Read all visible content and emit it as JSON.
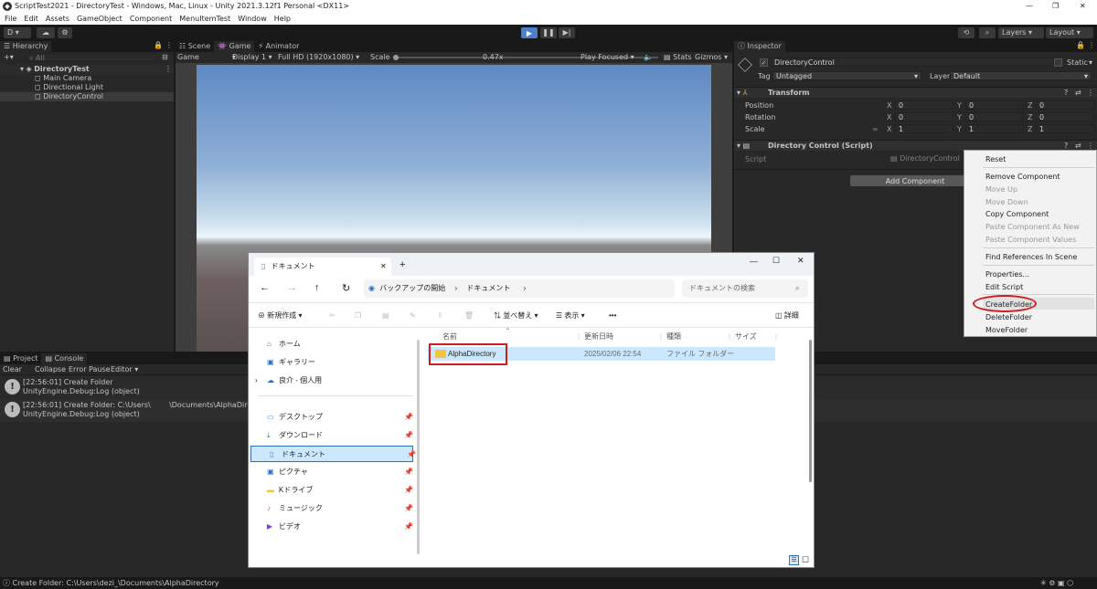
{
  "window": {
    "title": "ScriptTest2021 - DirectoryTest - Windows, Mac, Linux - Unity 2021.3.12f1 Personal <DX11>"
  },
  "menu": [
    "File",
    "Edit",
    "Assets",
    "GameObject",
    "Component",
    "MenuItemTest",
    "Window",
    "Help"
  ],
  "toolbar": {
    "account": "D",
    "layers": "Layers",
    "layout": "Layout"
  },
  "hierarchy": {
    "tab": "Hierarchy",
    "search_placeholder": "All",
    "scene": "DirectoryTest",
    "items": [
      "Main Camera",
      "Directional Light",
      "DirectoryControl"
    ]
  },
  "scene_tabs": {
    "scene": "Scene",
    "game": "Game",
    "animator": "Animator"
  },
  "game_toolbar": {
    "display_mode": "Game",
    "display": "Display 1",
    "resolution": "Full HD (1920x1080)",
    "scale_label": "Scale",
    "scale_value": "0.47x",
    "play_focused": "Play Focused",
    "stats": "Stats",
    "gizmos": "Gizmos"
  },
  "inspector": {
    "tab": "Inspector",
    "object_name": "DirectoryControl",
    "static_label": "Static",
    "tag_label": "Tag",
    "tag_value": "Untagged",
    "layer_label": "Layer",
    "layer_value": "Default",
    "transform": {
      "title": "Transform",
      "rows": [
        {
          "label": "Position",
          "x": "0",
          "y": "0",
          "z": "0"
        },
        {
          "label": "Rotation",
          "x": "0",
          "y": "0",
          "z": "0"
        },
        {
          "label": "Scale",
          "x": "1",
          "y": "1",
          "z": "1"
        }
      ]
    },
    "script_component": {
      "title": "Directory Control (Script)",
      "script_label": "Script",
      "script_value": "DirectoryControl"
    },
    "add_component": "Add Component"
  },
  "context_menu": {
    "items": [
      {
        "label": "Reset",
        "enabled": true
      },
      {
        "label": "Remove Component",
        "enabled": true
      },
      {
        "label": "Move Up",
        "enabled": false
      },
      {
        "label": "Move Down",
        "enabled": false
      },
      {
        "label": "Copy Component",
        "enabled": true
      },
      {
        "label": "Paste Component As New",
        "enabled": false
      },
      {
        "label": "Paste Component Values",
        "enabled": false
      },
      {
        "label": "Find References In Scene",
        "enabled": true
      },
      {
        "label": "Properties...",
        "enabled": true
      },
      {
        "label": "Edit Script",
        "enabled": true
      },
      {
        "label": "CreateFolder",
        "enabled": true
      },
      {
        "label": "DeleteFolder",
        "enabled": true
      },
      {
        "label": "MoveFolder",
        "enabled": true
      }
    ]
  },
  "console": {
    "tabs": {
      "project": "Project",
      "console": "Console"
    },
    "buttons": {
      "clear": "Clear",
      "collapse": "Collapse",
      "error_pause": "Error Pause",
      "editor": "Editor"
    },
    "entries": [
      {
        "line1": "[22:56:01] Create Folder",
        "line2": "UnityEngine.Debug:Log (object)"
      },
      {
        "line1": "[22:56:01] Create Folder: C:\\Users\\        \\Documents\\AlphaDirectory",
        "line2": "UnityEngine.Debug:Log (object)"
      }
    ]
  },
  "status_bar": {
    "text": "Create Folder: C:\\Users\\dezi_\\Documents\\AlphaDirectory"
  },
  "explorer": {
    "tab_title": "ドキュメント",
    "new_tab": "+",
    "breadcrumb": [
      "バックアップの開始",
      "ドキュメント"
    ],
    "search_placeholder": "ドキュメントの検索",
    "toolbar": {
      "new": "新規作成",
      "sort": "並べ替え",
      "view": "表示",
      "more": "•••",
      "details": "詳細"
    },
    "nav_items": [
      {
        "label": "ホーム",
        "icon": "home-icon",
        "pinned": false
      },
      {
        "label": "ギャラリー",
        "icon": "gallery-icon",
        "pinned": false
      },
      {
        "label": "良介 - 個人用",
        "icon": "cloud-icon",
        "pinned": false
      },
      {
        "label": "デスクトップ",
        "icon": "desktop-icon",
        "pinned": true
      },
      {
        "label": "ダウンロード",
        "icon": "download-icon",
        "pinned": true
      },
      {
        "label": "ドキュメント",
        "icon": "document-icon",
        "pinned": true
      },
      {
        "label": "ピクチャ",
        "icon": "pictures-icon",
        "pinned": true
      },
      {
        "label": "Kドライブ",
        "icon": "folder-icon",
        "pinned": true
      },
      {
        "label": "ミュージック",
        "icon": "music-icon",
        "pinned": true
      },
      {
        "label": "ビデオ",
        "icon": "video-icon",
        "pinned": true
      }
    ],
    "columns": [
      "名前",
      "更新日時",
      "種類",
      "サイズ"
    ],
    "files": [
      {
        "name": "AlphaDirectory",
        "modified": "2025/02/06 22:54",
        "type": "ファイル フォルダー",
        "size": ""
      }
    ]
  },
  "colors": {
    "unity_dark": "#282828",
    "highlight_red": "#cc1e1e",
    "selection": "#cce8ff",
    "play_blue": "#4c7fc9"
  }
}
